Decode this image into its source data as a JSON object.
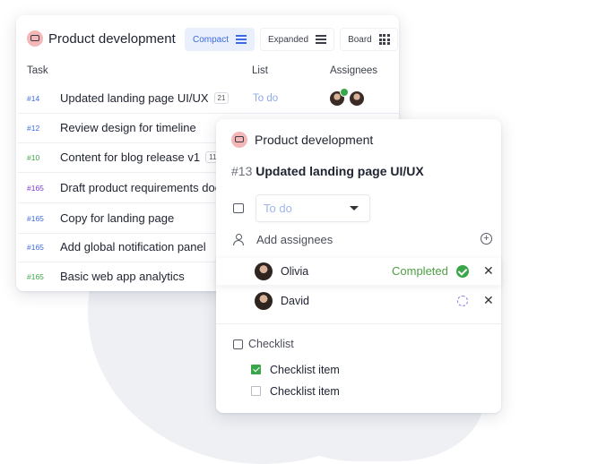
{
  "colors": {
    "accent": "#3d6ae0",
    "done": "#3aa64a",
    "todo": "#8ea9e8"
  },
  "back_card": {
    "project_title": "Product development",
    "views": [
      {
        "label": "Compact",
        "icon": "list-icon",
        "active": true
      },
      {
        "label": "Expanded",
        "icon": "list-icon",
        "active": false
      },
      {
        "label": "Board",
        "icon": "board-icon",
        "active": false
      }
    ],
    "columns": {
      "task": "Task",
      "list": "List",
      "assignees": "Assignees"
    },
    "tasks": [
      {
        "id": "#14",
        "id_color": "#3d6ae0",
        "name": "Updated landing page UI/UX",
        "count": "21",
        "list": "To do"
      },
      {
        "id": "#12",
        "id_color": "#3d6ae0",
        "name": "Review design for timeline",
        "count": "",
        "list": ""
      },
      {
        "id": "#10",
        "id_color": "#3aa64a",
        "name": "Content for blog release v1",
        "count": "11",
        "list": ""
      },
      {
        "id": "#165",
        "id_color": "#7a3ad0",
        "name": "Draft product requirements doc",
        "count": "",
        "list": ""
      },
      {
        "id": "#165",
        "id_color": "#3d6ae0",
        "name": "Copy for landing page",
        "count": "",
        "list": ""
      },
      {
        "id": "#165",
        "id_color": "#3d6ae0",
        "name": "Add global notification panel",
        "count": "",
        "list": ""
      },
      {
        "id": "#165",
        "id_color": "#3aa64a",
        "name": "Basic web app analytics",
        "count": "",
        "list": ""
      }
    ]
  },
  "front_card": {
    "project_title": "Product development",
    "task_number": "#13",
    "task_name": "Updated landing page UI/UX",
    "status_select": "To do",
    "add_assignees": "Add assignees",
    "assignees": [
      {
        "name": "Olivia",
        "status": "Completed",
        "state": "done"
      },
      {
        "name": "David",
        "status": "",
        "state": "pending"
      }
    ],
    "checklist_title": "Checklist",
    "checklist": [
      {
        "label": "Checklist item",
        "checked": true
      },
      {
        "label": "Checklist item",
        "checked": false
      }
    ]
  }
}
